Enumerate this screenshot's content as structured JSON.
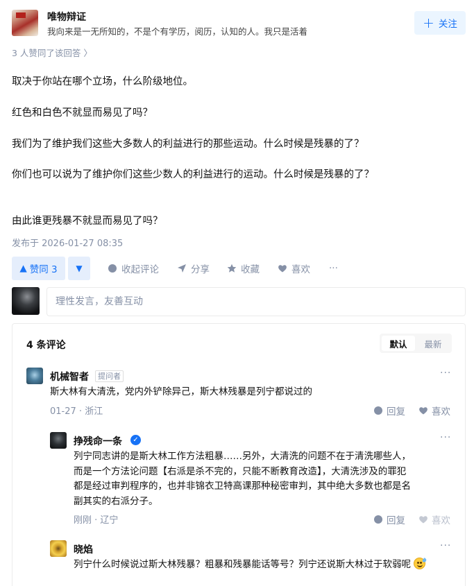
{
  "author": {
    "name": "唯物辩证",
    "bio": "我向来是一无所知的，不是个有学历，阅历，认知的人。我只是活着",
    "follow_label": "关注"
  },
  "upvoters_text": "3 人赞同了该回答 〉",
  "answer": {
    "paragraphs": [
      "取决于你站在哪个立场，什么阶级地位。",
      "红色和白色不就显而易见了吗？",
      "我们为了维护我们这些大多数人的利益进行的那些运动。什么时候是残暴的了？",
      "你们也可以说为了维护你们这些少数人的利益进行的运动。什么时候是残暴的了？",
      "由此谁更残暴不就显而易见了吗？"
    ],
    "published": "发布于 2026-01-27 08:35"
  },
  "actions": {
    "upvote_label": "赞同 3",
    "collapse_comments": "收起评论",
    "share": "分享",
    "favorite": "收藏",
    "like": "喜欢",
    "more": "···"
  },
  "comment_input": {
    "placeholder": "理性发言，友善互动"
  },
  "comments": {
    "title": "4 条评论",
    "sort_default": "默认",
    "sort_latest": "最新",
    "items": [
      {
        "name": "机械智者",
        "tag": "提问者",
        "text": "斯大林有大清洗，党内外铲除异己，斯大林残暴是列宁都说过的",
        "date": "01-27",
        "location": "浙江",
        "reply": "回复",
        "like": "喜欢"
      },
      {
        "name": "挣残命一条",
        "verified": true,
        "lines": [
          "列宁同志讲的是斯大林工作方法粗暴……另外，大清洗的问题不在于清洗哪些人，",
          "而是一个方法论问题【右派是杀不完的，只能不断教育改造】，大清洗涉及的罪犯",
          "都是经过审判程序的，也并非锦衣卫特高课那种秘密审判，其中绝大多数也都是名",
          "副其实的右派分子。"
        ],
        "date": "刚刚",
        "location": "辽宁",
        "reply": "回复",
        "like": "喜欢"
      },
      {
        "name": "晓焰",
        "text": "列宁什么时候说过斯大林残暴？粗暴和残暴能话等号？列宁还说斯大林过于软弱呢",
        "emoji": "sweat-smile-emoji"
      }
    ]
  }
}
